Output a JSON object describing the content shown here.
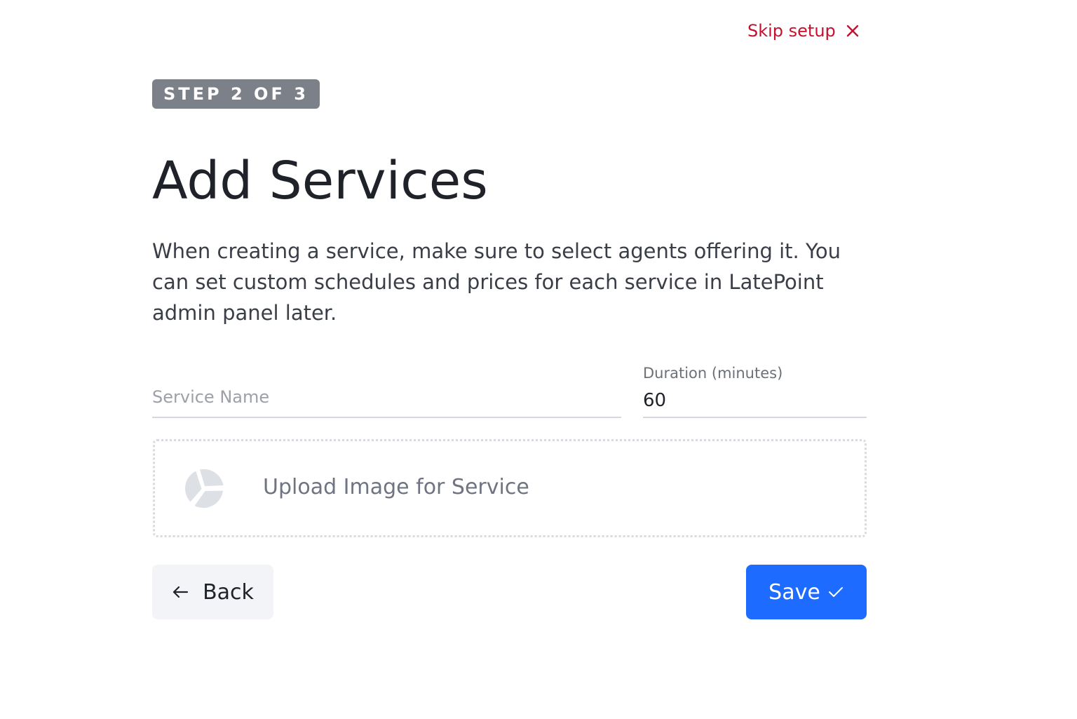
{
  "header": {
    "skip_label": "Skip setup",
    "skip_icon": "close-icon"
  },
  "step": {
    "label": "STEP 2 OF 3"
  },
  "page": {
    "title": "Add Services",
    "description": "When creating a service, make sure to select agents offering it. You can set custom schedules and prices for each service in LatePoint admin panel later."
  },
  "form": {
    "service_name": {
      "placeholder": "Service Name",
      "value": ""
    },
    "duration": {
      "label": "Duration (minutes)",
      "value": "60"
    },
    "upload": {
      "label": "Upload Image for Service",
      "icon": "image-placeholder-icon"
    }
  },
  "actions": {
    "back_label": "Back",
    "back_icon": "arrow-left-icon",
    "save_label": "Save",
    "save_icon": "checkmark-icon"
  },
  "colors": {
    "accent": "#1d6bff",
    "skip": "#c3112f",
    "badge": "#7c8089"
  }
}
